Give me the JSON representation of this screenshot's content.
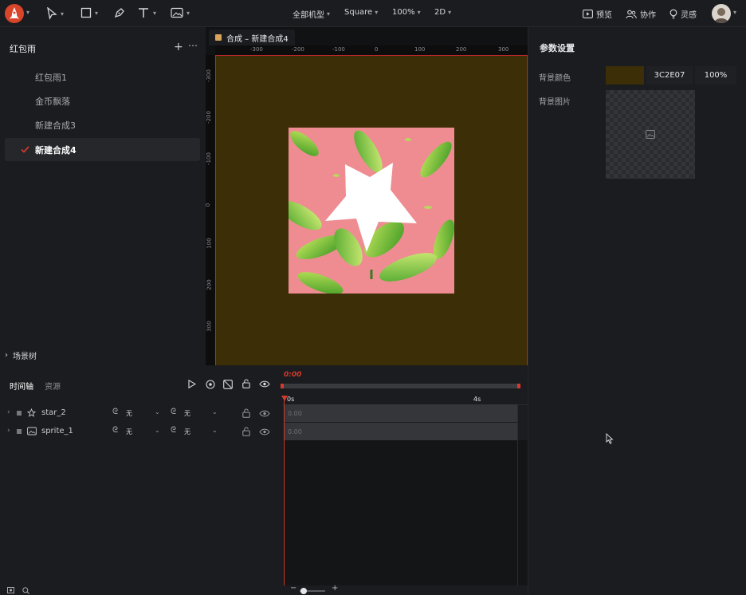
{
  "toolbar": {
    "model_select": "全部机型",
    "shape_select": "Square",
    "zoom_select": "100%",
    "mode_select": "2D",
    "preview_label": "预览",
    "collab_label": "协作",
    "inspire_label": "灵感"
  },
  "sidebar": {
    "title": "红包雨",
    "compositions": [
      {
        "label": "红包雨1"
      },
      {
        "label": "金币飘落"
      },
      {
        "label": "新建合成3"
      },
      {
        "label": "新建合成4"
      }
    ],
    "scene_tree_label": "场景树"
  },
  "canvas": {
    "tab_label": "合成 – 新建合成4",
    "ruler_top": [
      "-300",
      "-200",
      "-100",
      "0",
      "100",
      "200",
      "300"
    ],
    "ruler_left": [
      "-300",
      "-200",
      "-100",
      "0",
      "100",
      "200",
      "300"
    ]
  },
  "params": {
    "title": "参数设置",
    "bg_color_label": "背景颜色",
    "bg_color_hex": "3C2E07",
    "bg_color_opacity": "100%",
    "bg_image_label": "背景图片",
    "bg_color_value": "#3C2E07"
  },
  "timeline": {
    "tab_timeline": "时间轴",
    "tab_assets": "资源",
    "current_time": "0:00",
    "tick_start": "0s",
    "tick_mid": "4s",
    "layers": [
      {
        "name": "star_2",
        "opt1": "无",
        "opt2": "无",
        "track_value": "0.00"
      },
      {
        "name": "sprite_1",
        "opt1": "无",
        "opt2": "无",
        "track_value": "0.00"
      }
    ]
  },
  "colors": {
    "accent": "#d33a2c",
    "panel": "#1b1c1f"
  }
}
